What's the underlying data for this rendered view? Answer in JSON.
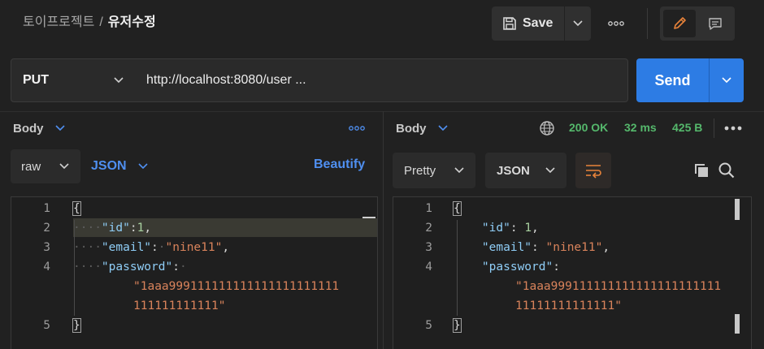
{
  "breadcrumb": {
    "parent": "토이프로젝트",
    "separator": "/",
    "current": "유저수정"
  },
  "toolbar": {
    "save_label": "Save"
  },
  "request": {
    "method": "PUT",
    "url": "http://localhost:8080/user ...",
    "send_label": "Send"
  },
  "left_pane": {
    "section_label": "Body",
    "body_type": "raw",
    "format": "JSON",
    "beautify_label": "Beautify",
    "code": {
      "line_numbers": [
        "1",
        "2",
        "3",
        "4",
        "5"
      ],
      "open_brace": "{",
      "close_brace": "}",
      "key_id": "\"id\"",
      "val_id": "1",
      "key_email": "\"email\"",
      "val_email": "\"nine11\"",
      "key_password": "\"password\"",
      "val_password_1": "\"1aaa999111111111111111111111",
      "val_password_2": "111111111111\""
    }
  },
  "right_pane": {
    "section_label": "Body",
    "status": "200 OK",
    "time": "32 ms",
    "size": "425 B",
    "view_mode": "Pretty",
    "format": "JSON",
    "code": {
      "line_numbers": [
        "1",
        "2",
        "3",
        "4",
        "5"
      ],
      "open_brace": "{",
      "close_brace": "}",
      "key_id": "\"id\"",
      "val_id": "1",
      "key_email": "\"email\"",
      "val_email": "\"nine11\"",
      "key_password": "\"password\"",
      "val_password_1": "\"1aaa999111111111111111111111",
      "val_password_2": "11111111111111\""
    }
  },
  "colors": {
    "accent": "#2d7ce4",
    "status_ok": "#55b86c",
    "json_key": "#8fcdf6",
    "json_string": "#d9835b",
    "link": "#4f8ff0",
    "edit_active": "#e8833a"
  },
  "icons": [
    "save-icon",
    "chevron-down-icon",
    "more-icon",
    "pencil-icon",
    "comment-icon",
    "globe-icon",
    "wrap-lines-icon",
    "copy-icon",
    "search-icon"
  ]
}
